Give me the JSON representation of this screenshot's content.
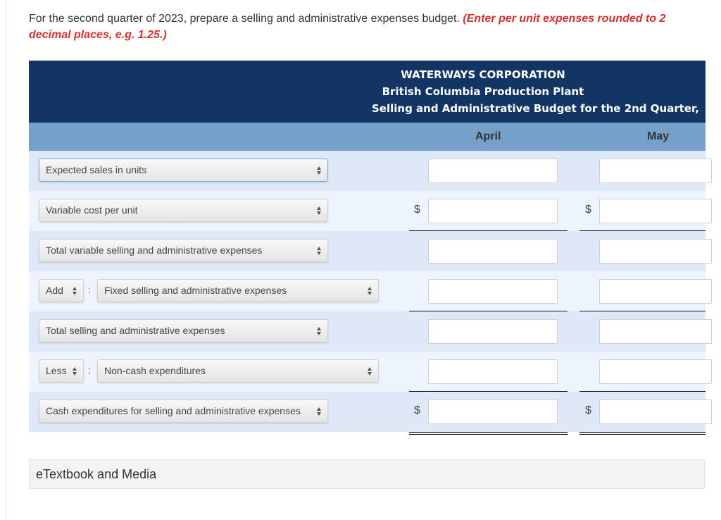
{
  "prompt": {
    "text": "For the second quarter of 2023, prepare a selling and administrative expenses budget.",
    "hint": "(Enter per unit expenses rounded to 2 decimal places, e.g. 1.25.)"
  },
  "budget": {
    "company": "WATERWAYS CORPORATION",
    "plant": "British Columbia Production Plant",
    "title": "Selling and Administrative Budget for the 2nd Quarter,",
    "columns": [
      "April",
      "May"
    ],
    "rows": [
      {
        "label": "Expected sales in units",
        "prefix": null,
        "dollar": false,
        "values": [
          "",
          ""
        ]
      },
      {
        "label": "Variable cost per unit",
        "prefix": null,
        "dollar": true,
        "values": [
          "",
          ""
        ]
      },
      {
        "label": "Total variable selling and administrative expenses",
        "prefix": null,
        "dollar": false,
        "values": [
          "",
          ""
        ]
      },
      {
        "label": "Fixed selling and administrative expenses",
        "prefix": "Add",
        "dollar": false,
        "values": [
          "",
          ""
        ]
      },
      {
        "label": "Total selling and administrative expenses",
        "prefix": null,
        "dollar": false,
        "values": [
          "",
          ""
        ]
      },
      {
        "label": "Non-cash expenditures",
        "prefix": "Less",
        "dollar": false,
        "values": [
          "",
          ""
        ]
      },
      {
        "label": "Cash expenditures for selling and administrative expenses",
        "prefix": null,
        "dollar": true,
        "values": [
          "",
          ""
        ]
      }
    ],
    "currency_symbol": "$",
    "separator": ":"
  },
  "footer": {
    "etextbook_label": "eTextbook and Media"
  },
  "colors": {
    "header_dark": "#123563",
    "header_light": "#74a0ca",
    "row_a": "#dfe8f6",
    "row_b": "#edf4fd",
    "hint_red": "#d3302f"
  }
}
